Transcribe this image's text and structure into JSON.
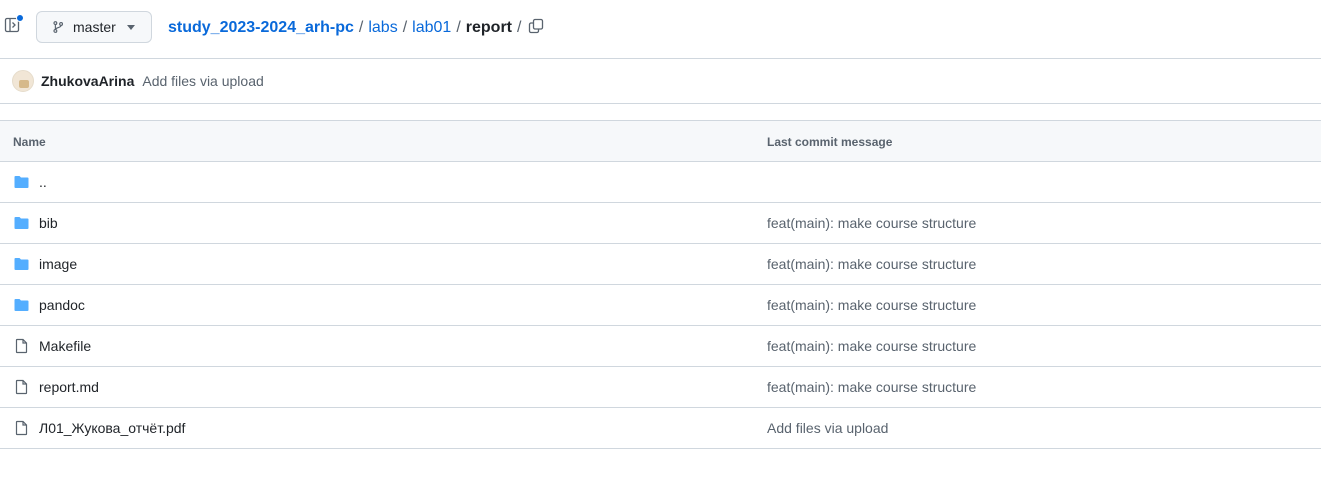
{
  "branch": {
    "name": "master"
  },
  "breadcrumb": {
    "repo": "study_2023-2024_arh-pc",
    "parts": [
      "labs",
      "lab01"
    ],
    "current": "report",
    "separator": "/"
  },
  "latest_commit": {
    "author": "ZhukovaArina",
    "message": "Add files via upload"
  },
  "table": {
    "headers": {
      "name": "Name",
      "message": "Last commit message"
    },
    "rows": [
      {
        "type": "parent",
        "name": "..",
        "message": ""
      },
      {
        "type": "folder",
        "name": "bib",
        "message": "feat(main): make course structure"
      },
      {
        "type": "folder",
        "name": "image",
        "message": "feat(main): make course structure"
      },
      {
        "type": "folder",
        "name": "pandoc",
        "message": "feat(main): make course structure"
      },
      {
        "type": "file",
        "name": "Makefile",
        "message": "feat(main): make course structure"
      },
      {
        "type": "file",
        "name": "report.md",
        "message": "feat(main): make course structure"
      },
      {
        "type": "file",
        "name": "Л01_Жукова_отчёт.pdf",
        "message": "Add files via upload"
      }
    ]
  },
  "colors": {
    "link": "#0969da",
    "folder": "#54aeff",
    "muted": "#59636e",
    "border": "#d0d7de",
    "header_bg": "#f6f8fa"
  },
  "icons": {
    "sidebar_toggle": "sidebar-expand-icon",
    "branch": "git-branch-icon",
    "copy": "copy-icon",
    "folder": "folder-icon",
    "file": "file-icon"
  }
}
